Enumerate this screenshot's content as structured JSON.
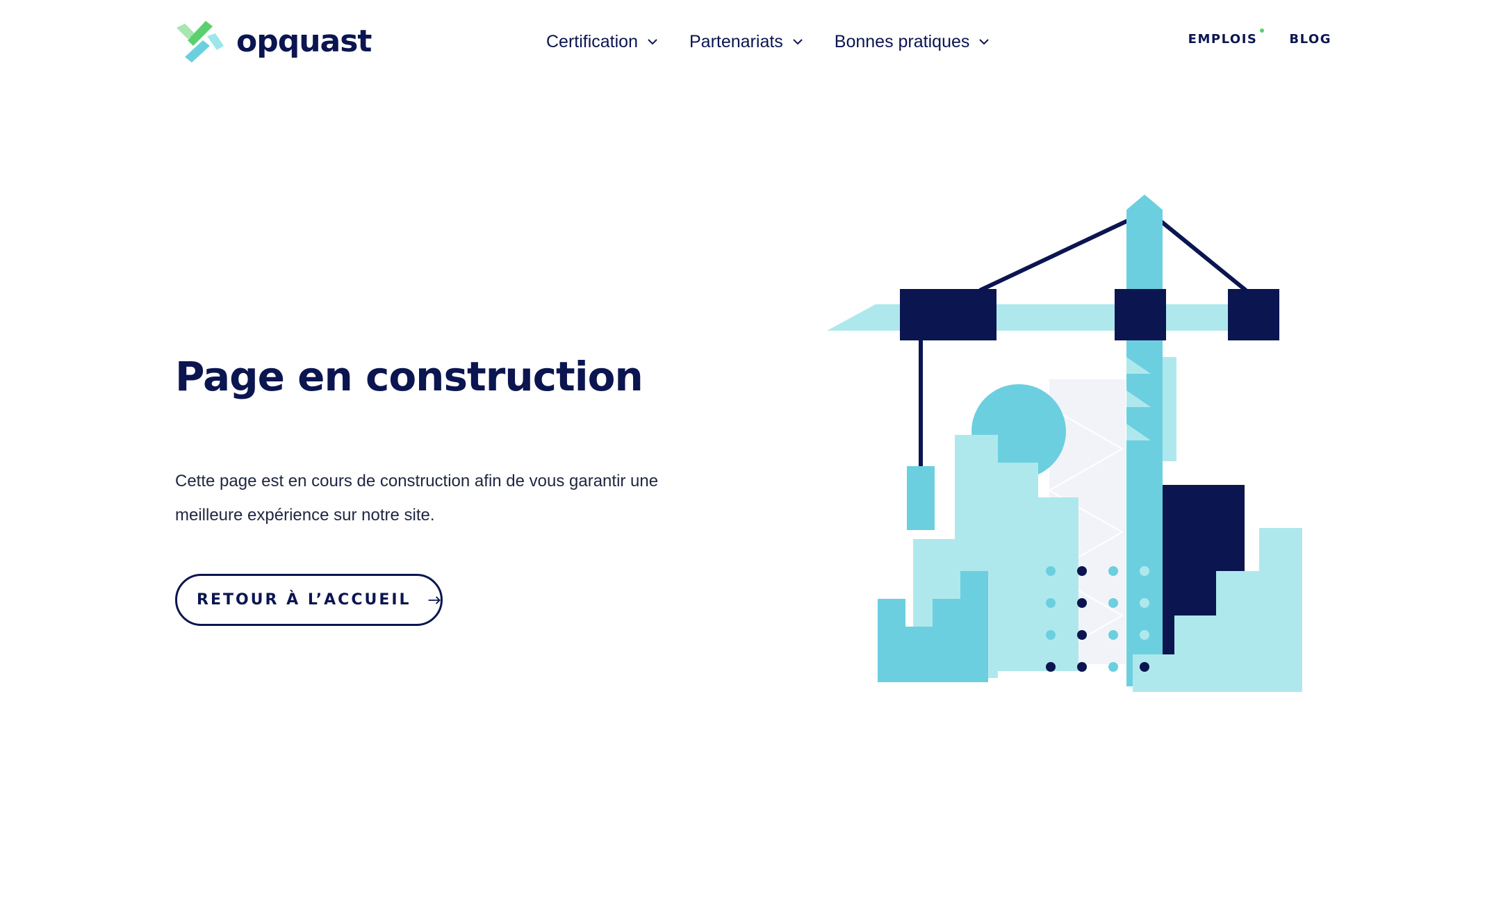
{
  "header": {
    "logo_text": "opquast",
    "nav": [
      {
        "label": "Certification"
      },
      {
        "label": "Partenariats"
      },
      {
        "label": "Bonnes pratiques"
      }
    ],
    "links": {
      "jobs": "EMPLOIS",
      "blog": "BLOG"
    }
  },
  "main": {
    "title": "Page en construction",
    "description": "Cette page est en cours de construction afin de vous garantir une meilleure expérience sur notre site.",
    "cta_label": "RETOUR À L’ACCUEIL"
  },
  "colors": {
    "navy": "#0b1550",
    "cyan": "#6ccfdf",
    "light_cyan": "#afe8ec",
    "pale": "#f2f3f8",
    "green": "#5ad06e"
  },
  "icons": [
    "opquast-logo-icon",
    "chevron-down-icon",
    "arrow-right-icon",
    "construction-illustration"
  ]
}
